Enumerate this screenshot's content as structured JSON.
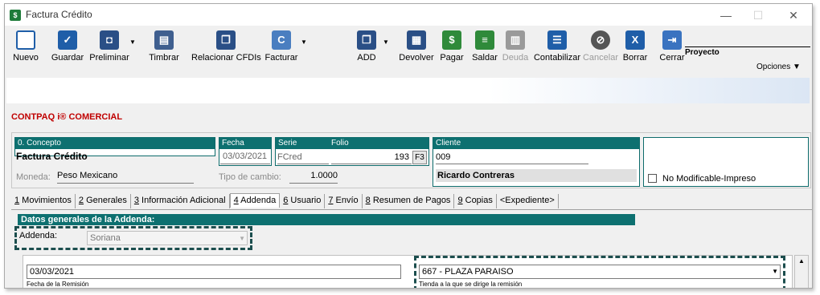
{
  "window": {
    "title": "Factura Crédito",
    "minimize": "—",
    "maximize": "☐",
    "close": "✕"
  },
  "toolbar": {
    "nuevo": "Nuevo",
    "guardar": "Guardar",
    "preliminar": "Preliminar",
    "timbrar": "Timbrar",
    "relacionar": "Relacionar CFDIs",
    "facturar": "Facturar",
    "add": "ADD",
    "devolver": "Devolver",
    "pagar": "Pagar",
    "saldar": "Saldar",
    "deuda": "Deuda",
    "contabilizar": "Contabilizar",
    "cancelar": "Cancelar",
    "borrar": "Borrar",
    "cerrar": "Cerrar",
    "proyecto": "Proyecto",
    "opciones": "Opciones"
  },
  "brand": "CONTPAQ i® COMERCIAL",
  "concepto": {
    "header": "0. Concepto",
    "value": "Factura Crédito"
  },
  "moneda": {
    "label": "Moneda:",
    "value": "Peso Mexicano"
  },
  "tipo_cambio": {
    "label": "Tipo de cambio:",
    "value": "1.0000"
  },
  "fecha": {
    "header": "Fecha",
    "value": "03/03/2021"
  },
  "serie": {
    "header": "Serie",
    "value": "FCred"
  },
  "folio": {
    "header": "Folio",
    "value": "193",
    "f3": "F3"
  },
  "cliente": {
    "header": "Cliente",
    "code": "009",
    "name": "Ricardo Contreras"
  },
  "no_modificable": "No Modificable-Impreso",
  "tabs": [
    {
      "num": "1",
      "label": " Movimientos"
    },
    {
      "num": "2",
      "label": " Generales"
    },
    {
      "num": "3",
      "label": " Información Adicional"
    },
    {
      "num": "4",
      "label": " Addenda"
    },
    {
      "num": "6",
      "label": " Usuario"
    },
    {
      "num": "7",
      "label": " Envío"
    },
    {
      "num": "8",
      "label": " Resumen de Pagos"
    },
    {
      "num": "9",
      "label": " Copias"
    },
    {
      "num": "",
      "label": "<Expediente>"
    }
  ],
  "addenda": {
    "header": "Datos generales de la Addenda:",
    "label": "Addenda:",
    "value": "Soriana",
    "fecha_remision_value": "03/03/2021",
    "fecha_remision_label": "Fecha de la Remisión",
    "tienda_value": "667 - PLAZA PARAISO",
    "tienda_label": "Tienda a la que se dirige la remisión"
  },
  "colors": {
    "teal": "#0d7070",
    "brand_red": "#c00000",
    "icon_blue": "#1f5ea8"
  },
  "icons": [
    "nuevo-icon",
    "guardar-icon",
    "preliminar-icon",
    "timbrar-icon",
    "relacionar-icon",
    "facturar-icon",
    "add-icon",
    "devolver-icon",
    "pagar-icon",
    "saldar-icon",
    "deuda-icon",
    "contabilizar-icon",
    "cancelar-icon",
    "borrar-icon",
    "cerrar-icon"
  ]
}
